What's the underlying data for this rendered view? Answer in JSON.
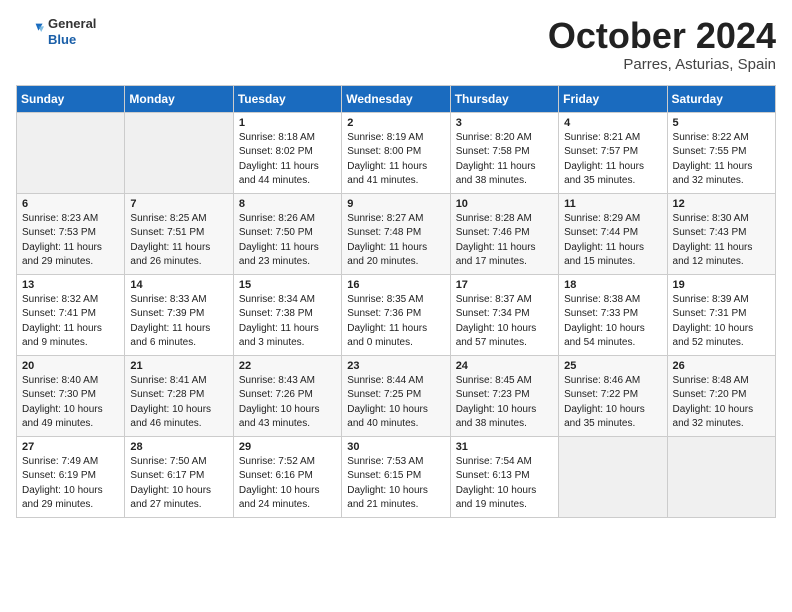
{
  "header": {
    "logo_general": "General",
    "logo_blue": "Blue",
    "month_title": "October 2024",
    "location": "Parres, Asturias, Spain"
  },
  "days_of_week": [
    "Sunday",
    "Monday",
    "Tuesday",
    "Wednesday",
    "Thursday",
    "Friday",
    "Saturday"
  ],
  "weeks": [
    [
      {
        "day": "",
        "info": ""
      },
      {
        "day": "",
        "info": ""
      },
      {
        "day": "1",
        "info": "Sunrise: 8:18 AM\nSunset: 8:02 PM\nDaylight: 11 hours\nand 44 minutes."
      },
      {
        "day": "2",
        "info": "Sunrise: 8:19 AM\nSunset: 8:00 PM\nDaylight: 11 hours\nand 41 minutes."
      },
      {
        "day": "3",
        "info": "Sunrise: 8:20 AM\nSunset: 7:58 PM\nDaylight: 11 hours\nand 38 minutes."
      },
      {
        "day": "4",
        "info": "Sunrise: 8:21 AM\nSunset: 7:57 PM\nDaylight: 11 hours\nand 35 minutes."
      },
      {
        "day": "5",
        "info": "Sunrise: 8:22 AM\nSunset: 7:55 PM\nDaylight: 11 hours\nand 32 minutes."
      }
    ],
    [
      {
        "day": "6",
        "info": "Sunrise: 8:23 AM\nSunset: 7:53 PM\nDaylight: 11 hours\nand 29 minutes."
      },
      {
        "day": "7",
        "info": "Sunrise: 8:25 AM\nSunset: 7:51 PM\nDaylight: 11 hours\nand 26 minutes."
      },
      {
        "day": "8",
        "info": "Sunrise: 8:26 AM\nSunset: 7:50 PM\nDaylight: 11 hours\nand 23 minutes."
      },
      {
        "day": "9",
        "info": "Sunrise: 8:27 AM\nSunset: 7:48 PM\nDaylight: 11 hours\nand 20 minutes."
      },
      {
        "day": "10",
        "info": "Sunrise: 8:28 AM\nSunset: 7:46 PM\nDaylight: 11 hours\nand 17 minutes."
      },
      {
        "day": "11",
        "info": "Sunrise: 8:29 AM\nSunset: 7:44 PM\nDaylight: 11 hours\nand 15 minutes."
      },
      {
        "day": "12",
        "info": "Sunrise: 8:30 AM\nSunset: 7:43 PM\nDaylight: 11 hours\nand 12 minutes."
      }
    ],
    [
      {
        "day": "13",
        "info": "Sunrise: 8:32 AM\nSunset: 7:41 PM\nDaylight: 11 hours\nand 9 minutes."
      },
      {
        "day": "14",
        "info": "Sunrise: 8:33 AM\nSunset: 7:39 PM\nDaylight: 11 hours\nand 6 minutes."
      },
      {
        "day": "15",
        "info": "Sunrise: 8:34 AM\nSunset: 7:38 PM\nDaylight: 11 hours\nand 3 minutes."
      },
      {
        "day": "16",
        "info": "Sunrise: 8:35 AM\nSunset: 7:36 PM\nDaylight: 11 hours\nand 0 minutes."
      },
      {
        "day": "17",
        "info": "Sunrise: 8:37 AM\nSunset: 7:34 PM\nDaylight: 10 hours\nand 57 minutes."
      },
      {
        "day": "18",
        "info": "Sunrise: 8:38 AM\nSunset: 7:33 PM\nDaylight: 10 hours\nand 54 minutes."
      },
      {
        "day": "19",
        "info": "Sunrise: 8:39 AM\nSunset: 7:31 PM\nDaylight: 10 hours\nand 52 minutes."
      }
    ],
    [
      {
        "day": "20",
        "info": "Sunrise: 8:40 AM\nSunset: 7:30 PM\nDaylight: 10 hours\nand 49 minutes."
      },
      {
        "day": "21",
        "info": "Sunrise: 8:41 AM\nSunset: 7:28 PM\nDaylight: 10 hours\nand 46 minutes."
      },
      {
        "day": "22",
        "info": "Sunrise: 8:43 AM\nSunset: 7:26 PM\nDaylight: 10 hours\nand 43 minutes."
      },
      {
        "day": "23",
        "info": "Sunrise: 8:44 AM\nSunset: 7:25 PM\nDaylight: 10 hours\nand 40 minutes."
      },
      {
        "day": "24",
        "info": "Sunrise: 8:45 AM\nSunset: 7:23 PM\nDaylight: 10 hours\nand 38 minutes."
      },
      {
        "day": "25",
        "info": "Sunrise: 8:46 AM\nSunset: 7:22 PM\nDaylight: 10 hours\nand 35 minutes."
      },
      {
        "day": "26",
        "info": "Sunrise: 8:48 AM\nSunset: 7:20 PM\nDaylight: 10 hours\nand 32 minutes."
      }
    ],
    [
      {
        "day": "27",
        "info": "Sunrise: 7:49 AM\nSunset: 6:19 PM\nDaylight: 10 hours\nand 29 minutes."
      },
      {
        "day": "28",
        "info": "Sunrise: 7:50 AM\nSunset: 6:17 PM\nDaylight: 10 hours\nand 27 minutes."
      },
      {
        "day": "29",
        "info": "Sunrise: 7:52 AM\nSunset: 6:16 PM\nDaylight: 10 hours\nand 24 minutes."
      },
      {
        "day": "30",
        "info": "Sunrise: 7:53 AM\nSunset: 6:15 PM\nDaylight: 10 hours\nand 21 minutes."
      },
      {
        "day": "31",
        "info": "Sunrise: 7:54 AM\nSunset: 6:13 PM\nDaylight: 10 hours\nand 19 minutes."
      },
      {
        "day": "",
        "info": ""
      },
      {
        "day": "",
        "info": ""
      }
    ]
  ]
}
